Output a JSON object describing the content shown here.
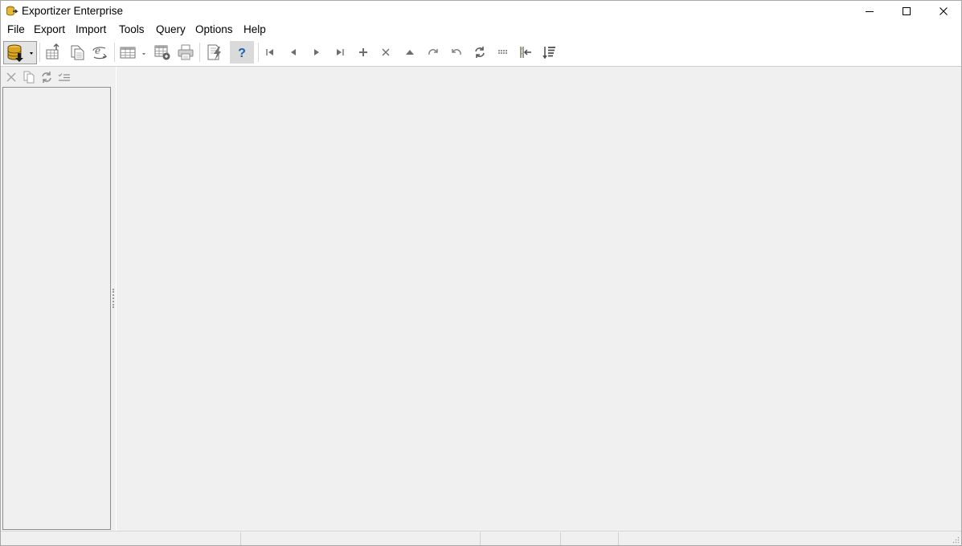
{
  "window": {
    "title": "Exportizer Enterprise",
    "icons": [
      "app-icon",
      "minimize-icon",
      "maximize-icon",
      "close-icon"
    ]
  },
  "menu": {
    "items": [
      {
        "label": "File"
      },
      {
        "label": "Export"
      },
      {
        "label": "Import"
      },
      {
        "label": "Tools"
      },
      {
        "label": "Query"
      },
      {
        "label": "Options"
      },
      {
        "label": "Help"
      }
    ]
  },
  "toolbar": {
    "buttons": [
      {
        "icon": "open-database-icon"
      },
      {
        "icon": "export-icon"
      },
      {
        "icon": "copy-to-clipboard-icon"
      },
      {
        "icon": "open-url-icon"
      },
      {
        "icon": "grid-view-icon"
      },
      {
        "icon": "export-table-icon"
      },
      {
        "icon": "print-icon"
      },
      {
        "icon": "edit-sql-icon"
      },
      {
        "icon": "help-icon"
      },
      {
        "icon": "first-record-icon"
      },
      {
        "icon": "prior-record-icon"
      },
      {
        "icon": "next-record-icon"
      },
      {
        "icon": "last-record-icon"
      },
      {
        "icon": "insert-record-icon"
      },
      {
        "icon": "delete-record-icon"
      },
      {
        "icon": "post-edit-icon"
      },
      {
        "icon": "redo-icon"
      },
      {
        "icon": "undo-icon"
      },
      {
        "icon": "refresh-icon"
      },
      {
        "icon": "columns-icon"
      },
      {
        "icon": "first-column-icon"
      },
      {
        "icon": "sort-icon"
      }
    ]
  },
  "left_panel": {
    "tools": [
      {
        "icon": "delete-icon"
      },
      {
        "icon": "copy-icon"
      },
      {
        "icon": "refresh-icon"
      },
      {
        "icon": "check-list-icon"
      }
    ],
    "items": []
  },
  "status_bar": {
    "panels": [
      "",
      "",
      "",
      "",
      ""
    ]
  },
  "colors": {
    "window_bg": "#f0f0f0",
    "title_bg": "#ffffff",
    "help_blue": "#1a5fb4",
    "icon_gray": "#6e6e6e",
    "db_gold": "#c89a1e"
  }
}
